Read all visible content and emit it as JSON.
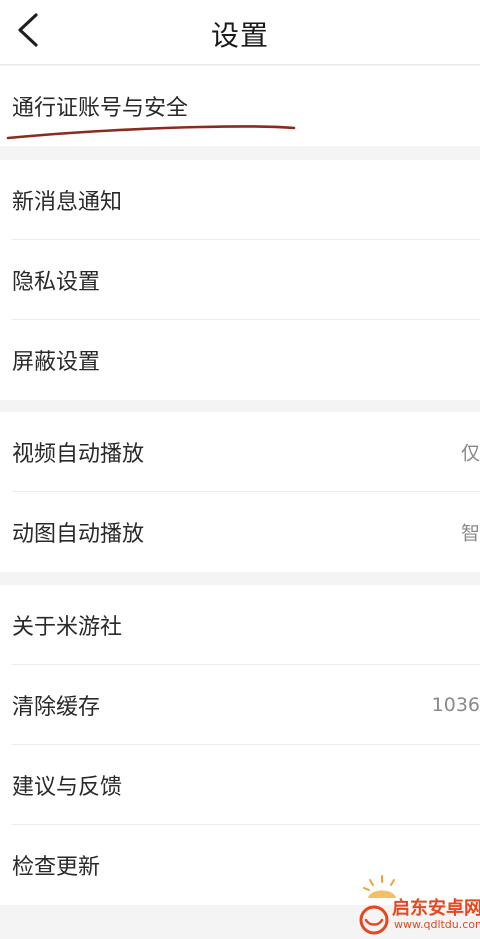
{
  "header": {
    "title": "设置",
    "back_icon": "chevron-left-icon"
  },
  "groups": [
    {
      "items": [
        {
          "label": "通行证账号与安全",
          "value": ""
        }
      ]
    },
    {
      "items": [
        {
          "label": "新消息通知",
          "value": ""
        },
        {
          "label": "隐私设置",
          "value": ""
        },
        {
          "label": "屏蔽设置",
          "value": ""
        }
      ]
    },
    {
      "items": [
        {
          "label": "视频自动播放",
          "value": "仅"
        },
        {
          "label": "动图自动播放",
          "value": "智"
        }
      ]
    },
    {
      "items": [
        {
          "label": "关于米游社",
          "value": ""
        },
        {
          "label": "清除缓存",
          "value": "1036"
        },
        {
          "label": "建议与反馈",
          "value": ""
        },
        {
          "label": "检查更新",
          "value": ""
        }
      ]
    }
  ],
  "annotation": {
    "color": "#8b2a1e"
  },
  "watermark": {
    "name": "启东安卓网",
    "url": "www.qdltdu.com",
    "color": "#e5471e"
  }
}
